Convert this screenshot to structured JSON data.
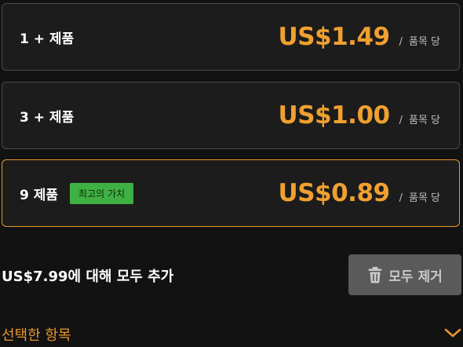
{
  "tiers": [
    {
      "quantity": "1 + 제품",
      "badge": "",
      "price": "US$1.49",
      "separator": "/",
      "unit": "품목 당"
    },
    {
      "quantity": "3 + 제품",
      "badge": "",
      "price": "US$1.00",
      "separator": "/",
      "unit": "품목 당"
    },
    {
      "quantity": "9 제품",
      "badge": "최고의 가치",
      "price": "US$0.89",
      "separator": "/",
      "unit": "품목 당"
    }
  ],
  "actions": {
    "add_all_label": "US$7.99에 대해 모두 추가",
    "remove_all_label": "모두 제거"
  },
  "selected_items": {
    "title": "선택한 항목"
  },
  "icons": {
    "remove": "trash-icon",
    "expand": "chevron-down-icon"
  },
  "colors": {
    "accent": "#f0a030",
    "badge": "#3fb043",
    "selected_border": "#e8962e",
    "disabled_button": "#5a5a5a"
  }
}
